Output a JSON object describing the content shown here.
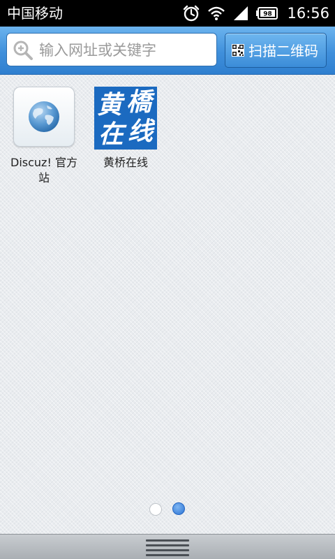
{
  "status_bar": {
    "carrier": "中国移动",
    "battery": "98",
    "time": "16:56"
  },
  "search": {
    "placeholder": "输入网址或关键字",
    "scan_label": "扫描二维码"
  },
  "shortcuts": [
    {
      "label": "Discuz! 官方站",
      "icon": "globe-icon"
    },
    {
      "label": "黄桥在线",
      "icon": "huangqiao-logo",
      "logo_text": [
        "黄",
        "橋",
        "在",
        "线"
      ]
    }
  ],
  "pagination": {
    "total": 2,
    "current": 2
  },
  "colors": {
    "header_blue": "#3f8fdb",
    "logo_blue": "#1b6ac0",
    "active_dot": "#2b73d4"
  }
}
